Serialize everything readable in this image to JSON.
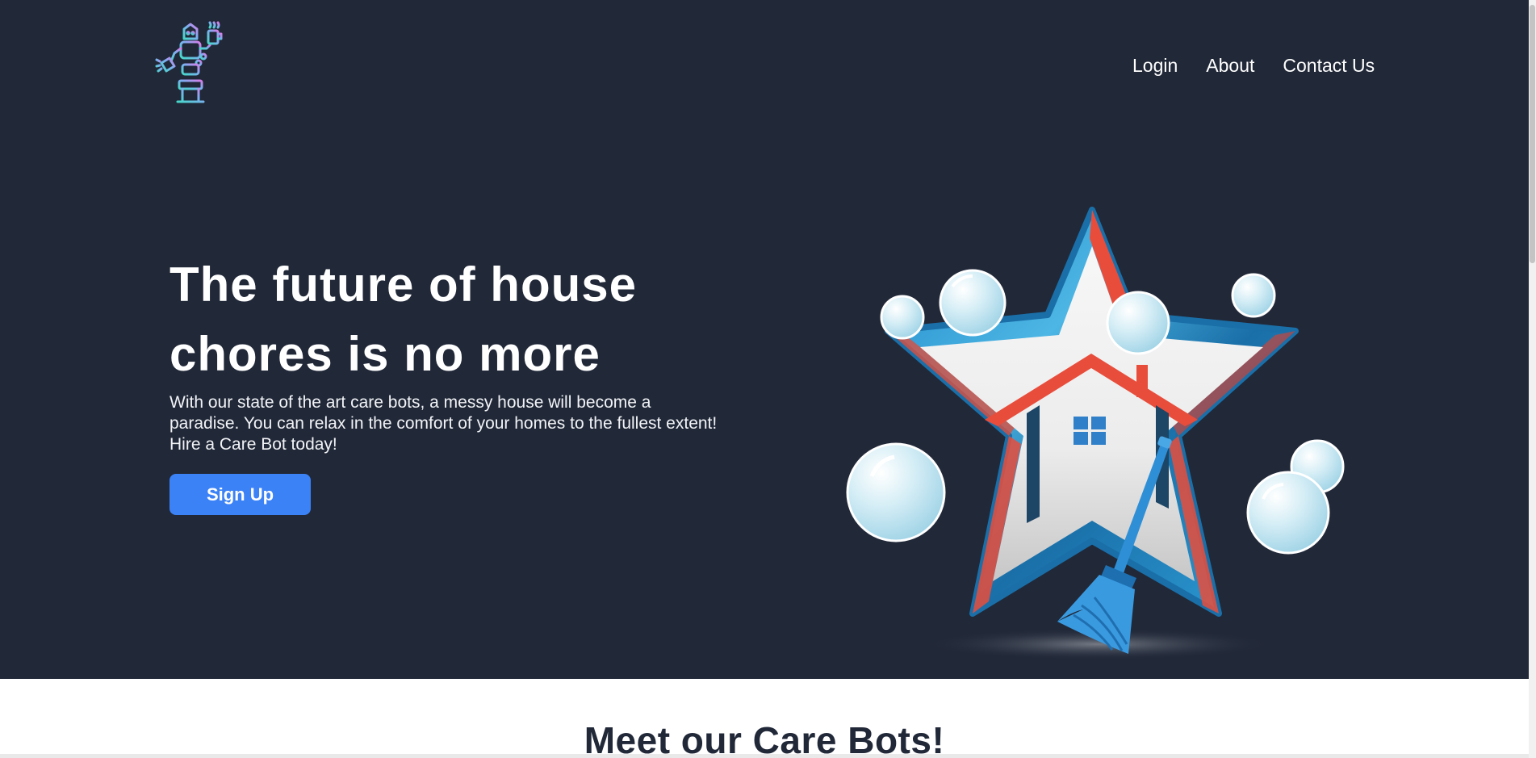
{
  "nav": {
    "items": [
      {
        "label": "Login"
      },
      {
        "label": "About"
      },
      {
        "label": "Contact Us"
      }
    ]
  },
  "hero": {
    "title_line1": "The future of house",
    "title_line2": "chores is no more",
    "description": "With our state of the art care bots, a messy house will become a paradise. You can relax in the comfort of your homes to the fullest extent! Hire a Care Bot today!",
    "signup_label": "Sign Up"
  },
  "section": {
    "title": "Meet our Care Bots!"
  },
  "colors": {
    "background": "#212838",
    "button": "#3b82f6",
    "star_red": "#e84d3c",
    "star_blue": "#1f87c8",
    "house_navy": "#1d4565"
  },
  "icons": {
    "logo": "robot-cleaning-icon",
    "illustration": "house-star-broom-bubbles"
  }
}
